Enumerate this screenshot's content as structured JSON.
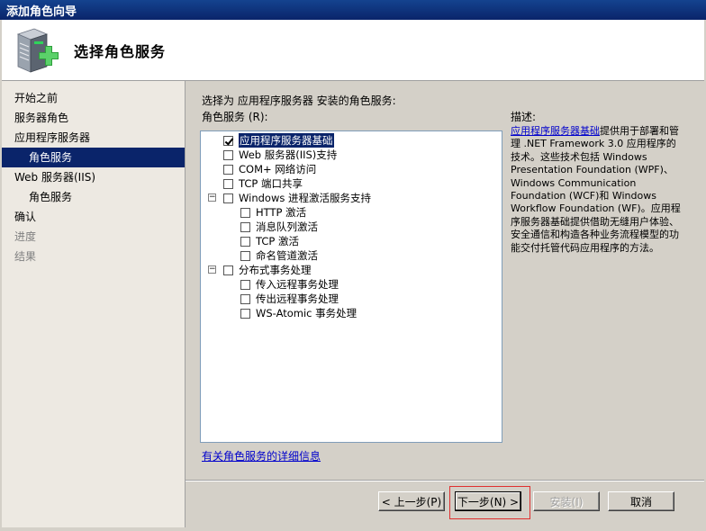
{
  "window": {
    "title": "添加角色向导"
  },
  "header": {
    "title": "选择角色服务"
  },
  "sidebar": {
    "items": [
      {
        "label": "开始之前",
        "state": "normal"
      },
      {
        "label": "服务器角色",
        "state": "normal"
      },
      {
        "label": "应用程序服务器",
        "state": "normal"
      },
      {
        "label": "角色服务",
        "state": "selected"
      },
      {
        "label": "Web 服务器(IIS)",
        "state": "normal"
      },
      {
        "label": "角色服务",
        "state": "normal"
      },
      {
        "label": "确认",
        "state": "normal"
      },
      {
        "label": "进度",
        "state": "disabled"
      },
      {
        "label": "结果",
        "state": "disabled"
      }
    ]
  },
  "main": {
    "intro": "选择为 应用程序服务器 安装的角色服务:",
    "list_label": "角色服务 (R):",
    "services": [
      {
        "label": "应用程序服务器基础",
        "checked": true,
        "selected": true
      },
      {
        "label": "Web 服务器(IIS)支持",
        "checked": false
      },
      {
        "label": "COM+ 网络访问",
        "checked": false
      },
      {
        "label": "TCP 端口共享",
        "checked": false
      },
      {
        "label": "Windows 进程激活服务支持",
        "checked": false,
        "expanded": true
      },
      {
        "label": "HTTP 激活",
        "checked": false
      },
      {
        "label": "消息队列激活",
        "checked": false
      },
      {
        "label": "TCP 激活",
        "checked": false
      },
      {
        "label": "命名管道激活",
        "checked": false
      },
      {
        "label": "分布式事务处理",
        "checked": false,
        "expanded": true
      },
      {
        "label": "传入远程事务处理",
        "checked": false
      },
      {
        "label": "传出远程事务处理",
        "checked": false
      },
      {
        "label": "WS-Atomic 事务处理",
        "checked": false
      }
    ],
    "more_info_link": "有关角色服务的详细信息"
  },
  "description": {
    "title": "描述:",
    "link_text": "应用程序服务器基础",
    "body": "提供用于部署和管理 .NET Framework 3.0 应用程序的技术。这些技术包括 Windows Presentation Foundation (WPF)、Windows Communication Foundation (WCF)和 Windows Workflow Foundation (WF)。应用程序服务器基础提供借助无缝用户体验、安全通信和构造各种业务流程模型的功能交付托管代码应用程序的方法。"
  },
  "buttons": {
    "back": "< 上一步(P)",
    "next": "下一步(N) >",
    "install": "安装(I)",
    "cancel": "取消"
  },
  "icon": "server-add-icon",
  "colors": {
    "selection": "#0a246a",
    "title_bar": "#0a246a",
    "link": "#0000cc",
    "focus_highlight": "#e03030"
  }
}
